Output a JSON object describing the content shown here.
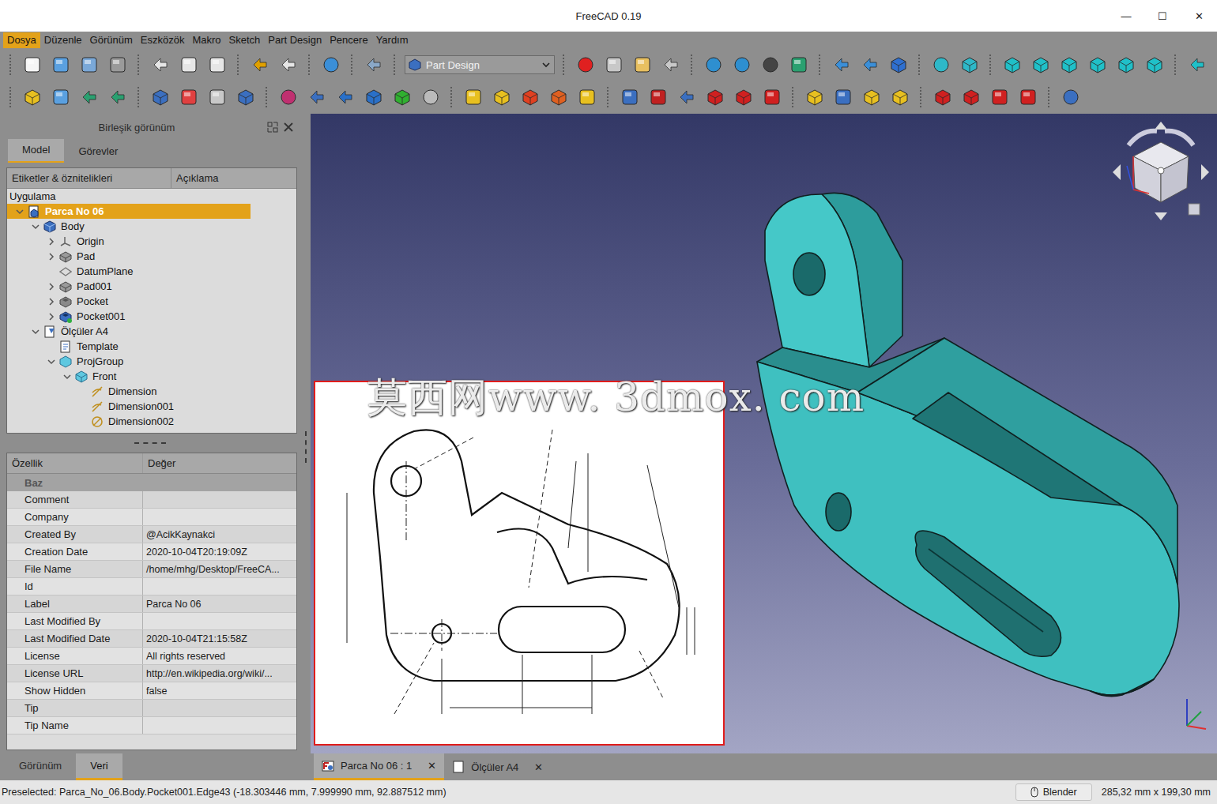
{
  "window": {
    "title": "FreeCAD 0.19",
    "controls": [
      "—",
      "☐",
      "✕"
    ]
  },
  "menu": [
    {
      "label": "Dosya",
      "selected": true
    },
    {
      "label": "Düzenle",
      "selected": false
    },
    {
      "label": "Görünüm",
      "selected": false
    },
    {
      "label": "Eszközök",
      "selected": false
    },
    {
      "label": "Makro",
      "selected": false
    },
    {
      "label": "Sketch",
      "selected": false
    },
    {
      "label": "Part Design",
      "selected": false
    },
    {
      "label": "Pencere",
      "selected": false
    },
    {
      "label": "Yardım",
      "selected": false
    }
  ],
  "workbench": {
    "label": "Part Design"
  },
  "combo_view": {
    "title": "Birleşik görünüm",
    "tabs": [
      {
        "label": "Model",
        "selected": true
      },
      {
        "label": "Görevler",
        "selected": false
      }
    ]
  },
  "tree": {
    "columns": [
      "Etiketler & öznitelikleri",
      "Açıklama"
    ],
    "items": [
      {
        "label": "Uygulama",
        "depth": 0,
        "kind": "root",
        "expandable": false,
        "expanded": false,
        "selected": false
      },
      {
        "label": "Parca No 06",
        "depth": 0,
        "kind": "document",
        "expandable": true,
        "expanded": true,
        "selected": true
      },
      {
        "label": "Body",
        "depth": 1,
        "kind": "body",
        "expandable": true,
        "expanded": true,
        "selected": false
      },
      {
        "label": "Origin",
        "depth": 2,
        "kind": "origin",
        "expandable": true,
        "expanded": false,
        "selected": false
      },
      {
        "label": "Pad",
        "depth": 2,
        "kind": "pad",
        "expandable": true,
        "expanded": false,
        "selected": false
      },
      {
        "label": "DatumPlane",
        "depth": 2,
        "kind": "datum",
        "expandable": false,
        "expanded": false,
        "selected": false
      },
      {
        "label": "Pad001",
        "depth": 2,
        "kind": "pad",
        "expandable": true,
        "expanded": false,
        "selected": false
      },
      {
        "label": "Pocket",
        "depth": 2,
        "kind": "pocket",
        "expandable": true,
        "expanded": false,
        "selected": false
      },
      {
        "label": "Pocket001",
        "depth": 2,
        "kind": "tip",
        "expandable": true,
        "expanded": false,
        "selected": false
      },
      {
        "label": "Ölçüler A4",
        "depth": 1,
        "kind": "page",
        "expandable": true,
        "expanded": true,
        "selected": false
      },
      {
        "label": "Template",
        "depth": 2,
        "kind": "template",
        "expandable": false,
        "expanded": false,
        "selected": false
      },
      {
        "label": "ProjGroup",
        "depth": 2,
        "kind": "projgroup",
        "expandable": true,
        "expanded": true,
        "selected": false
      },
      {
        "label": "Front",
        "depth": 3,
        "kind": "view",
        "expandable": true,
        "expanded": true,
        "selected": false
      },
      {
        "label": "Dimension",
        "depth": 4,
        "kind": "dimension",
        "expandable": false,
        "expanded": false,
        "selected": false
      },
      {
        "label": "Dimension001",
        "depth": 4,
        "kind": "dimension",
        "expandable": false,
        "expanded": false,
        "selected": false
      },
      {
        "label": "Dimension002",
        "depth": 4,
        "kind": "diameter",
        "expandable": false,
        "expanded": false,
        "selected": false
      }
    ]
  },
  "properties": {
    "columns": [
      "Özellik",
      "Değer"
    ],
    "group": "Baz",
    "rows": [
      {
        "name": "Comment",
        "value": ""
      },
      {
        "name": "Company",
        "value": ""
      },
      {
        "name": "Created By",
        "value": "@AcikKaynakci"
      },
      {
        "name": "Creation Date",
        "value": "2020-10-04T20:19:09Z"
      },
      {
        "name": "File Name",
        "value": "/home/mhg/Desktop/FreeCA..."
      },
      {
        "name": "Id",
        "value": ""
      },
      {
        "name": "Label",
        "value": "Parca No 06"
      },
      {
        "name": "Last Modified By",
        "value": ""
      },
      {
        "name": "Last Modified Date",
        "value": "2020-10-04T21:15:58Z"
      },
      {
        "name": "License",
        "value": "All rights reserved"
      },
      {
        "name": "License URL",
        "value": "http://en.wikipedia.org/wiki/..."
      },
      {
        "name": "Show Hidden",
        "value": "false"
      },
      {
        "name": "Tip",
        "value": ""
      },
      {
        "name": "Tip Name",
        "value": ""
      }
    ]
  },
  "panel_tabs": [
    {
      "label": "Görünüm",
      "selected": false
    },
    {
      "label": "Veri",
      "selected": true
    }
  ],
  "doc_tabs": [
    {
      "label": "Parca No 06 : 1",
      "selected": true,
      "close": "✕",
      "kind": "model"
    },
    {
      "label": "Ölçüler A4",
      "selected": false,
      "close": "✕",
      "kind": "page"
    }
  ],
  "watermark": "莫西网www. 3dmox. com",
  "status_bar": {
    "message": "Preselected: Parca_No_06.Body.Pocket001.Edge43 (-18.303446 mm, 7.999990 mm, 92.887512 mm)",
    "nav_style": "Blender",
    "dimensions": "285,32 mm x 199,30 mm"
  }
}
